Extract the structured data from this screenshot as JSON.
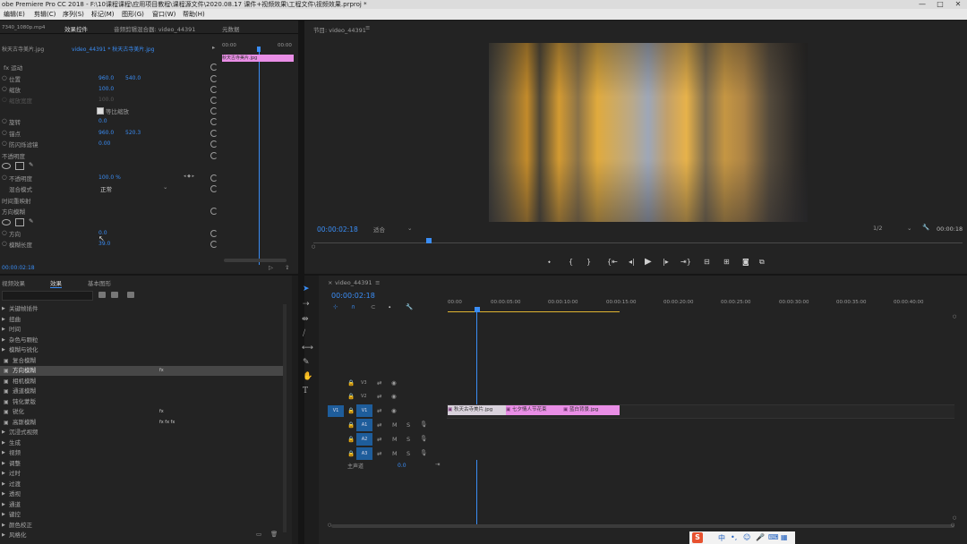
{
  "window": {
    "title": "obe Premiere Pro CC 2018 - F:\\10课程课程\\应用项目教程\\课程源文件\\2020.08.17 课件+视频效果\\工程文件\\视频效果.prproj *",
    "minimize": "—",
    "maximize": "□",
    "close": "✕"
  },
  "menu": [
    "编辑(E)",
    "剪辑(C)",
    "序列(S)",
    "标记(M)",
    "图形(G)",
    "窗口(W)",
    "帮助(H)"
  ],
  "source_panel": {
    "tabs": [
      "效果控件",
      "音频剪辑混合器: video_44391",
      "元数据"
    ],
    "left_label": "7340_1080p.mp4",
    "clip_dropdown": "秋天古寺美片.jpg",
    "clip_path": "video_44391 * 秋天古寺美片.jpg",
    "ruler_left": "00:00",
    "ruler_right": "00:00",
    "mini_clip": "秋天古寺美片.jpg",
    "timecode": "00:00:02:18",
    "section_motion": "fx 运动",
    "props": [
      {
        "label": "位置",
        "v1": "960.0",
        "v2": "540.0"
      },
      {
        "label": "缩放",
        "v1": "100.0",
        "v2": ""
      },
      {
        "label": "缩放宽度",
        "v1": "100.0",
        "v2": ""
      },
      {
        "label": "旋转",
        "v1": "0.0",
        "v2": ""
      },
      {
        "label": "锚点",
        "v1": "960.0",
        "v2": "520.3"
      },
      {
        "label": "防闪烁滤镜",
        "v1": "0.00",
        "v2": ""
      }
    ],
    "uniform_scale": "等比缩放",
    "section_opacity": "不透明度",
    "opacity_label": "不透明度",
    "opacity_value": "100.0 %",
    "blend_label": "混合模式",
    "blend_value": "正常",
    "section_time": "时间重映射",
    "section_blur": "方向模糊",
    "direction_label": "方向",
    "direction_value": "0.0",
    "blur_length_label": "模糊长度",
    "blur_length_value": "39.0"
  },
  "program": {
    "title": "节目: video_44391",
    "timecode": "00:00:02:18",
    "fit": "适合",
    "resolution": "1/2",
    "duration": "00:00:18"
  },
  "effects_panel": {
    "tabs": [
      "视频效果",
      "效果",
      "基本图形"
    ],
    "items": [
      {
        "label": "关键帧插件",
        "indent": 0,
        "badge": ""
      },
      {
        "label": "扭曲",
        "indent": 0,
        "badge": ""
      },
      {
        "label": "时间",
        "indent": 0,
        "badge": ""
      },
      {
        "label": "杂色与颗粒",
        "indent": 0,
        "badge": ""
      },
      {
        "label": "模糊与锐化",
        "indent": 0,
        "badge": ""
      },
      {
        "label": "复合模糊",
        "indent": 1,
        "badge": ""
      },
      {
        "label": "方向模糊",
        "indent": 1,
        "badge": "fx",
        "selected": true
      },
      {
        "label": "相机模糊",
        "indent": 1,
        "badge": ""
      },
      {
        "label": "通道模糊",
        "indent": 1,
        "badge": ""
      },
      {
        "label": "钝化蒙版",
        "indent": 1,
        "badge": ""
      },
      {
        "label": "锐化",
        "indent": 1,
        "badge": "fx"
      },
      {
        "label": "高斯模糊",
        "indent": 1,
        "badge": "fx fx fx"
      },
      {
        "label": "沉浸式视频",
        "indent": 0,
        "badge": ""
      },
      {
        "label": "生成",
        "indent": 0,
        "badge": ""
      },
      {
        "label": "视频",
        "indent": 0,
        "badge": ""
      },
      {
        "label": "调整",
        "indent": 0,
        "badge": ""
      },
      {
        "label": "过时",
        "indent": 0,
        "badge": ""
      },
      {
        "label": "过渡",
        "indent": 0,
        "badge": ""
      },
      {
        "label": "透视",
        "indent": 0,
        "badge": ""
      },
      {
        "label": "通道",
        "indent": 0,
        "badge": ""
      },
      {
        "label": "键控",
        "indent": 0,
        "badge": ""
      },
      {
        "label": "颜色校正",
        "indent": 0,
        "badge": ""
      },
      {
        "label": "风格化",
        "indent": 0,
        "badge": ""
      }
    ]
  },
  "timeline": {
    "sequence_tab": "video_44391",
    "timecode": "00:00:02:18",
    "ruler": [
      "00:00",
      "00:00:05:00",
      "00:00:10:00",
      "00:00:15:00",
      "00:00:20:00",
      "00:00:25:00",
      "00:00:30:00",
      "00:00:35:00",
      "00:00:40:00"
    ],
    "video_tracks": [
      "V3",
      "V2",
      "V1"
    ],
    "audio_tracks": [
      "A1",
      "A2",
      "A3"
    ],
    "source_v": "V1",
    "master_label": "主声道",
    "master_value": "0.0",
    "clips": [
      {
        "label": "秋天古寺美片.jpg",
        "color": "#d9d2dc"
      },
      {
        "label": "七夕情人节花束",
        "color": "#e98ee6"
      },
      {
        "label": "蓝白背景.jpg",
        "color": "#e98ee6"
      }
    ]
  },
  "taskbar": {
    "ime": "S",
    "items": [
      "中",
      "•,",
      "☺",
      "🎤",
      "⌨",
      "▦"
    ]
  }
}
